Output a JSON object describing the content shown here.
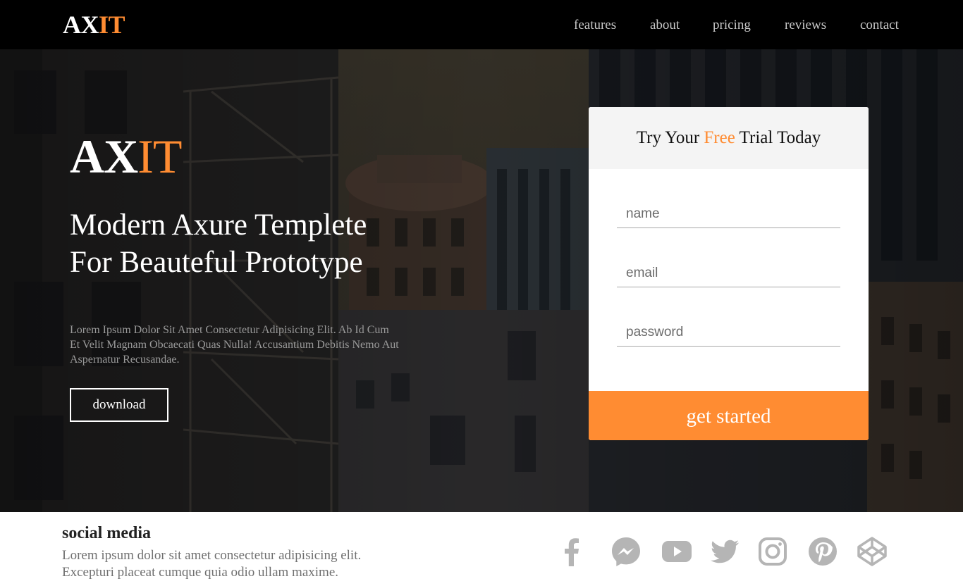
{
  "brand": {
    "main": "AX",
    "accent": "IT"
  },
  "nav": [
    {
      "label": "features"
    },
    {
      "label": "about"
    },
    {
      "label": "pricing"
    },
    {
      "label": "reviews"
    },
    {
      "label": "contact"
    }
  ],
  "hero": {
    "brand_main": "AX",
    "brand_accent": "IT",
    "headline_line1": "Modern Axure Templete",
    "headline_line2": "For Beauteful Prototype",
    "description": "Lorem Ipsum Dolor Sit Amet Consectetur Adipisicing Elit. Ab Id Cum Et Velit Magnam Obcaecati Quas Nulla! Accusantium Debitis Nemo Aut Aspernatur Recusandae.",
    "download_label": "download"
  },
  "signup": {
    "title_before": "Try Your ",
    "title_accent": "Free",
    "title_after": " Trial Today",
    "name_placeholder": "name",
    "email_placeholder": "email",
    "password_placeholder": "password",
    "submit_label": "get started"
  },
  "footer": {
    "title": "social media",
    "text_line1": "Lorem ipsum dolor sit amet consectetur adipisicing elit.",
    "text_line2": "Excepturi placeat cumque quia odio ullam maxime."
  },
  "social_icons": [
    "facebook-icon",
    "messenger-icon",
    "youtube-icon",
    "twitter-icon",
    "instagram-icon",
    "pinterest-icon",
    "codepen-icon"
  ],
  "colors": {
    "accent": "#ff8c32",
    "topbar": "#000000",
    "icon_gray": "#b5b5b5"
  }
}
